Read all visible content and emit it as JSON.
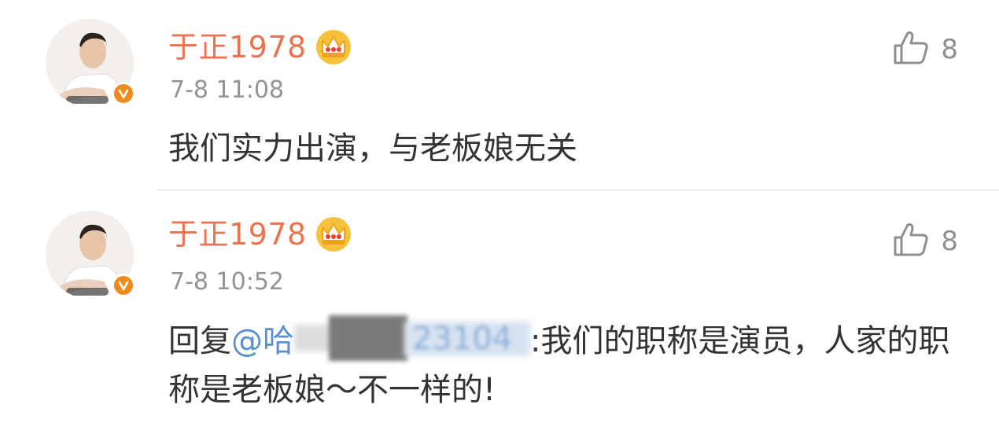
{
  "comments": [
    {
      "username": "于正1978",
      "timestamp": "7-8 11:08",
      "text": "我们实力出演，与老板娘无关",
      "likes": "8",
      "verified_icon": "v-badge-icon",
      "crown_icon": "crown-icon"
    },
    {
      "username": "于正1978",
      "timestamp": "7-8 10:52",
      "reply_prefix": "回复",
      "mention_visible": "@哈",
      "mention_tail": "23104",
      "reply_text": ":我们的职称是演员，人家的职称是老板娘～不一样的!",
      "likes": "8",
      "verified_icon": "v-badge-icon",
      "crown_icon": "crown-icon"
    }
  ],
  "colors": {
    "username": "#eb7350",
    "timestamp": "#939393",
    "body": "#333333",
    "mention": "#5b8fd1",
    "badge": "#f08a1c",
    "crown": "#f0a21c",
    "like": "#8f8f8f"
  }
}
